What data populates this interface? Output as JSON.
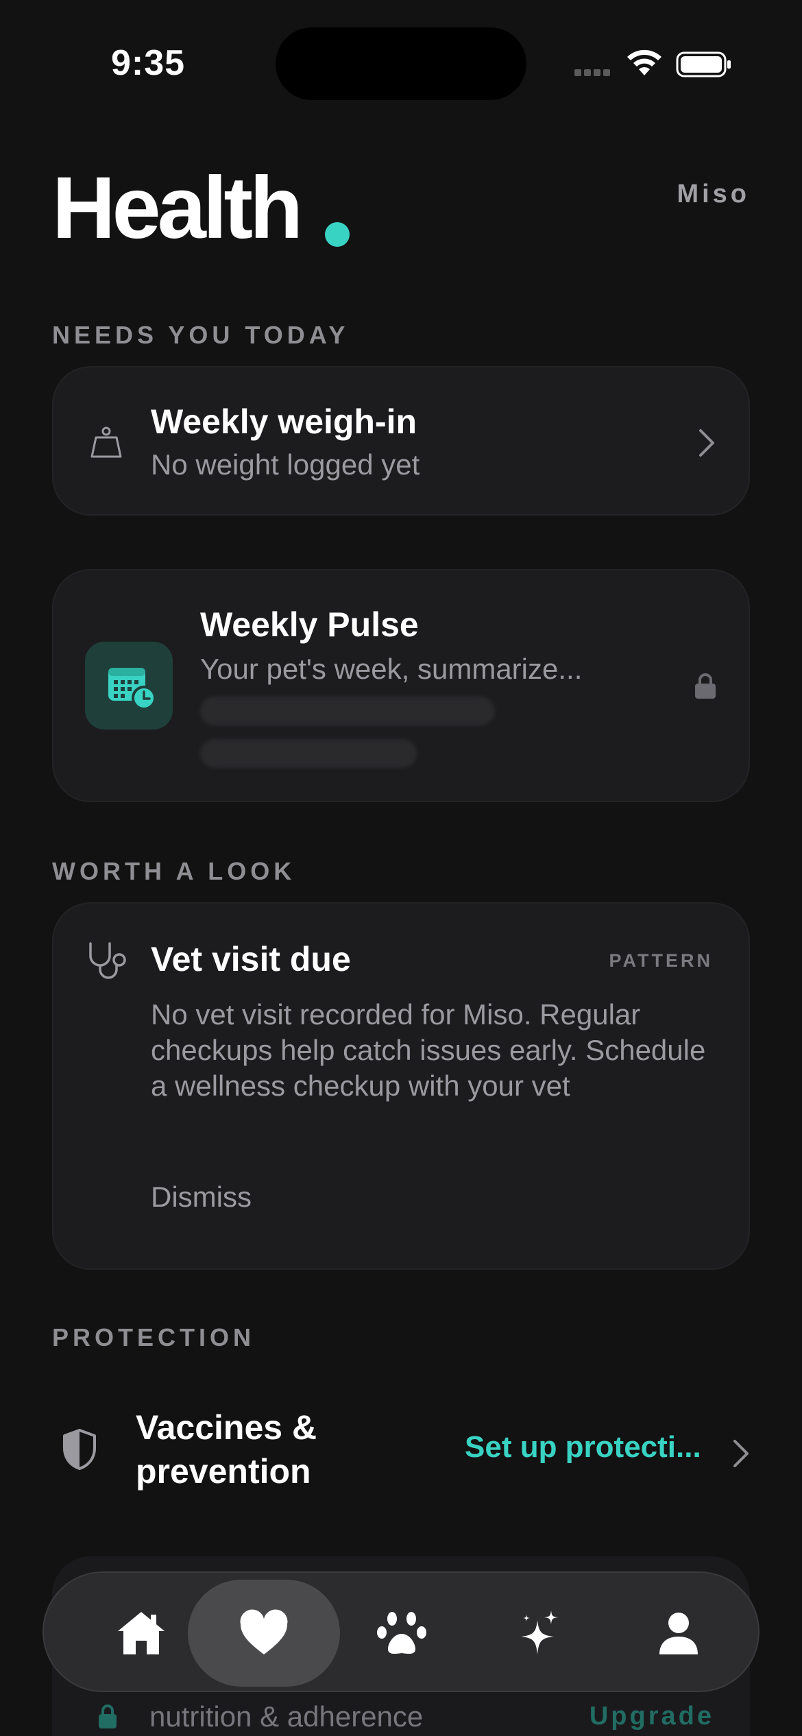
{
  "status_bar": {
    "time": "9:35"
  },
  "header": {
    "title": "Health",
    "pet_name": "Miso",
    "accent_color": "#39d3c3"
  },
  "needs_today": {
    "label": "NEEDS YOU TODAY",
    "weigh_in": {
      "title": "Weekly weigh-in",
      "subtitle": "No weight logged yet",
      "icon": "scale-icon"
    }
  },
  "weekly_pulse": {
    "title": "Weekly Pulse",
    "subtitle": "Your pet's week, summarize...",
    "icon": "calendar-clock-icon",
    "locked": true
  },
  "worth_a_look": {
    "label": "WORTH A LOOK",
    "vet_visit": {
      "title": "Vet visit due",
      "badge": "PATTERN",
      "body": "No vet visit recorded for Miso. Regular checkups help catch issues early. Schedule a wellness checkup with your vet",
      "dismiss": "Dismiss",
      "icon": "stethoscope-icon"
    }
  },
  "protection": {
    "label": "PROTECTION",
    "row": {
      "title": "Vaccines & prevention",
      "action": "Set up protecti...",
      "icon": "shield-icon"
    }
  },
  "hidden_card": {
    "text": "nutrition & adherence",
    "action": "Upgrade"
  },
  "tab_bar": {
    "tabs": [
      {
        "name": "home",
        "icon": "home-icon",
        "active": false
      },
      {
        "name": "health",
        "icon": "heart-icon",
        "active": true
      },
      {
        "name": "pets",
        "icon": "paw-icon",
        "active": false
      },
      {
        "name": "ai",
        "icon": "sparkle-icon",
        "active": false
      },
      {
        "name": "profile",
        "icon": "person-icon",
        "active": false
      }
    ]
  }
}
